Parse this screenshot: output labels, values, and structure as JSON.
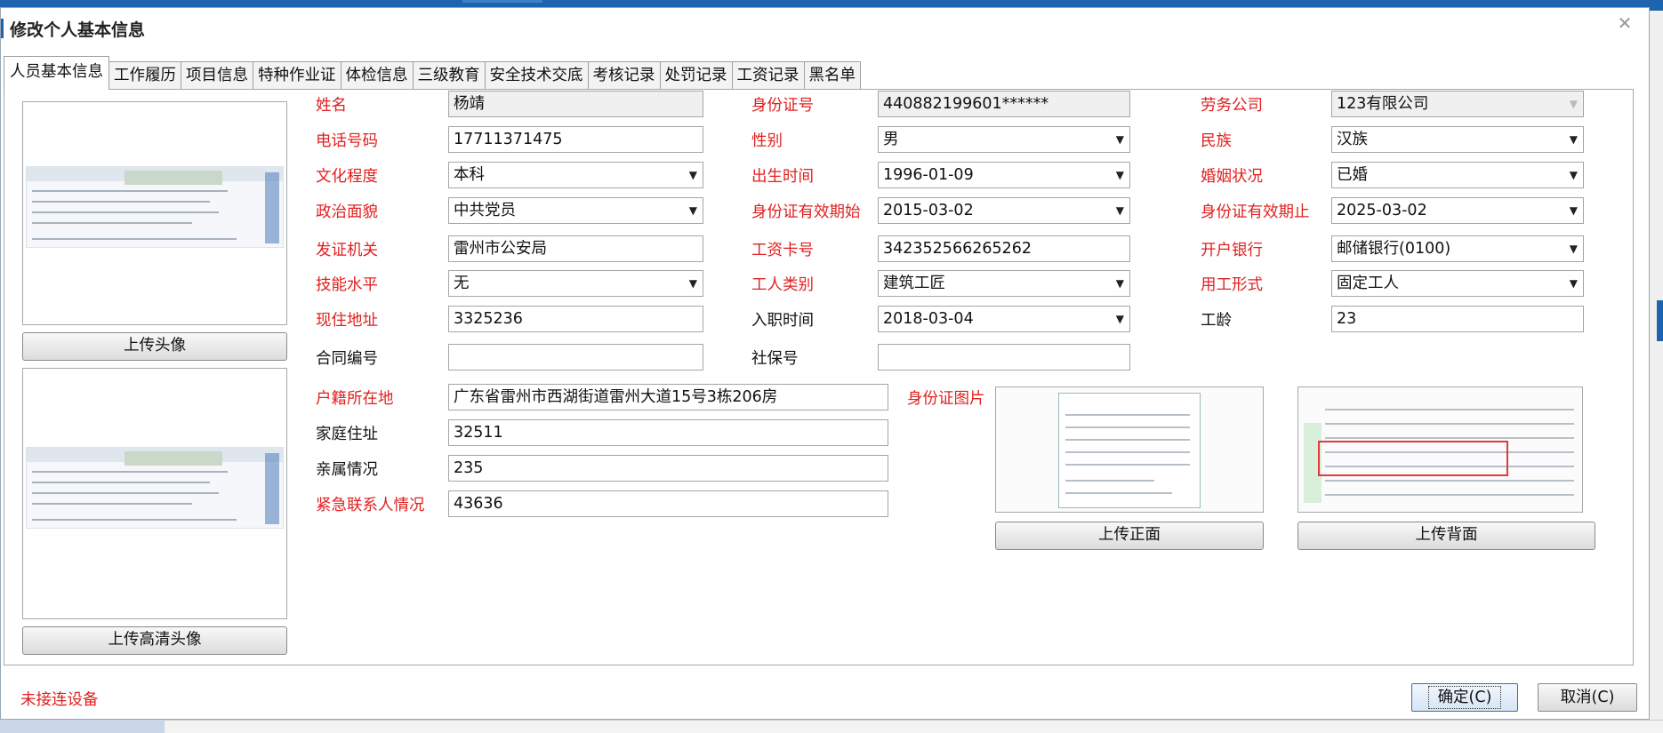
{
  "window": {
    "title": "修改个人基本信息",
    "status_text": "未接连设备",
    "ok_label": "确定(C)",
    "cancel_label": "取消(C)"
  },
  "tabs": [
    "人员基本信息",
    "工作履历",
    "项目信息",
    "特种作业证",
    "体检信息",
    "三级教育",
    "安全技术交底",
    "考核记录",
    "处罚记录",
    "工资记录",
    "黑名单"
  ],
  "photo": {
    "upload_avatar": "上传头像",
    "upload_hd_avatar": "上传高清头像"
  },
  "form": {
    "name": {
      "label": "姓名",
      "value": "杨靖"
    },
    "id_number": {
      "label": "身份证号",
      "value": "440882199601******"
    },
    "labor_company": {
      "label": "劳务公司",
      "value": "123有限公司"
    },
    "phone": {
      "label": "电话号码",
      "value": "17711371475"
    },
    "gender": {
      "label": "性别",
      "value": "男"
    },
    "ethnicity": {
      "label": "民族",
      "value": "汉族"
    },
    "education": {
      "label": "文化程度",
      "value": "本科"
    },
    "birth_date": {
      "label": "出生时间",
      "value": "1996-01-09"
    },
    "marital_status": {
      "label": "婚姻状况",
      "value": "已婚"
    },
    "political": {
      "label": "政治面貌",
      "value": "中共党员"
    },
    "id_valid_from": {
      "label": "身份证有效期始",
      "value": "2015-03-02"
    },
    "id_valid_to": {
      "label": "身份证有效期止",
      "value": "2025-03-02"
    },
    "issuing_office": {
      "label": "发证机关",
      "value": "雷州市公安局"
    },
    "salary_card": {
      "label": "工资卡号",
      "value": "342352566265262"
    },
    "bank": {
      "label": "开户银行",
      "value": "邮储银行(0100)"
    },
    "skill_level": {
      "label": "技能水平",
      "value": "无"
    },
    "worker_type": {
      "label": "工人类别",
      "value": "建筑工匠"
    },
    "employment_form": {
      "label": "用工形式",
      "value": "固定工人"
    },
    "current_address": {
      "label": "现住地址",
      "value": "3325236"
    },
    "entry_date": {
      "label": "入职时间",
      "value": "2018-03-04"
    },
    "seniority": {
      "label": "工龄",
      "value": "23"
    },
    "contract_no": {
      "label": "合同编号",
      "value": ""
    },
    "social_security": {
      "label": "社保号",
      "value": ""
    },
    "household_reg": {
      "label": "户籍所在地",
      "value": "广东省雷州市西湖街道雷州大道15号3栋206房"
    },
    "home_address": {
      "label": "家庭住址",
      "value": "32511"
    },
    "relatives": {
      "label": "亲属情况",
      "value": "235"
    },
    "emergency": {
      "label": "紧急联系人情况",
      "value": "43636"
    }
  },
  "id_card": {
    "label": "身份证图片",
    "upload_front": "上传正面",
    "upload_back": "上传背面"
  },
  "colors": {
    "required_label": "#e02020",
    "accent": "#1e63ad"
  }
}
